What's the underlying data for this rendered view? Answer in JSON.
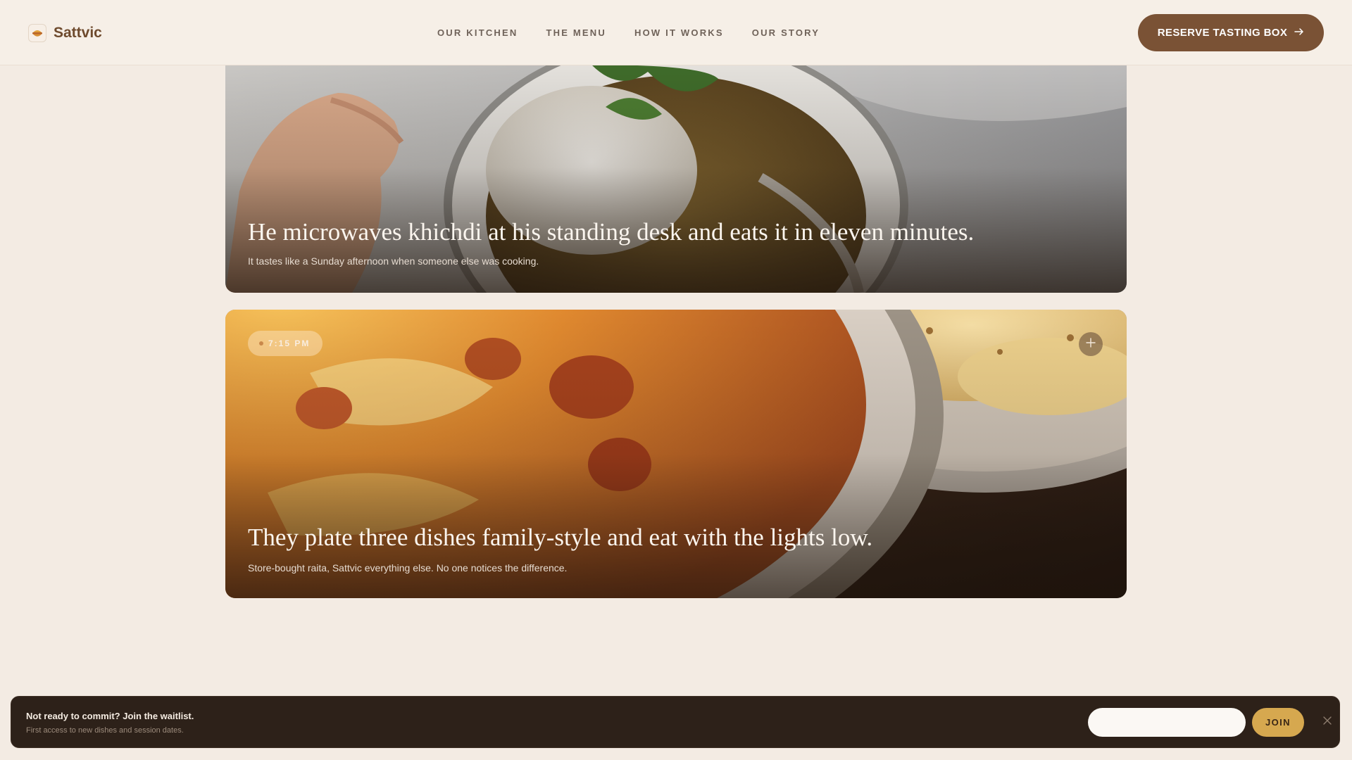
{
  "brand": {
    "name": "Sattvic",
    "logo_icon": "food-bowl-icon"
  },
  "nav": {
    "items": [
      {
        "label": "OUR KITCHEN"
      },
      {
        "label": "THE MENU"
      },
      {
        "label": "HOW IT WORKS"
      },
      {
        "label": "OUR STORY"
      }
    ]
  },
  "header": {
    "cta_label": "RESERVE TASTING BOX",
    "cta_icon": "arrow-right-icon"
  },
  "stories": [
    {
      "title": "He microwaves khichdi at his standing desk and eats it in eleven minutes.",
      "subtitle": "It tastes like a Sunday afternoon when someone else was cooking."
    },
    {
      "time": "7:15 PM",
      "title": "They plate three dishes family-style and eat with the lights low.",
      "subtitle": "Store-bought raita, Sattvic everything else. No one notices the difference.",
      "action_icon": "plus-icon"
    }
  ],
  "waitlist": {
    "title": "Not ready to commit? Join the waitlist.",
    "subtitle": "First access to new dishes and session dates.",
    "email_value": "",
    "join_label": "JOIN",
    "close_icon": "close-icon"
  },
  "colors": {
    "page_bg": "#f3ebe3",
    "brand": "#6e4a2d",
    "cta_bg": "#7a5235",
    "waitlist_bg": "#2d2119",
    "join_bg": "#d6a84f"
  }
}
